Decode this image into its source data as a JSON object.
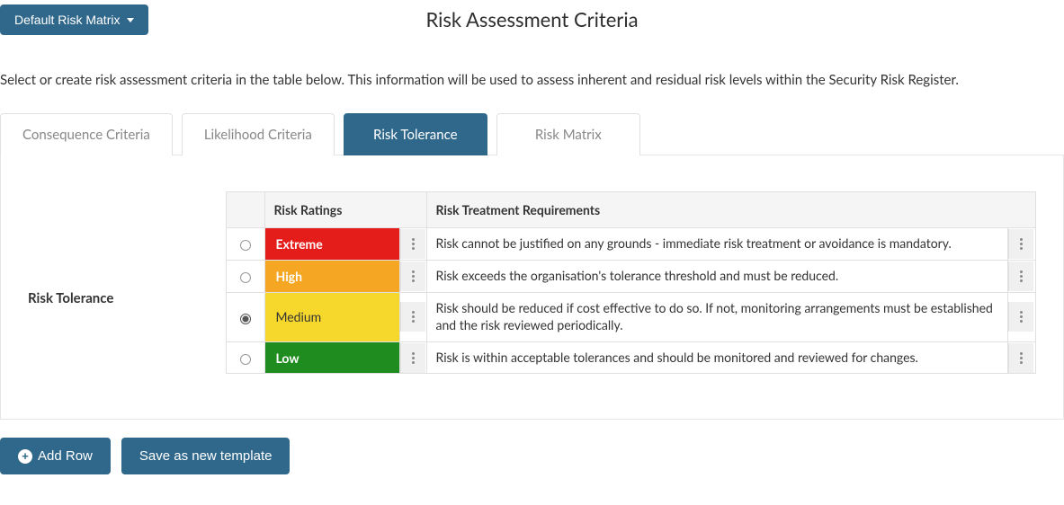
{
  "header": {
    "dropdown_label": "Default Risk Matrix",
    "title": "Risk Assessment Criteria"
  },
  "intro": "Select or create risk assessment criteria in the table below. This information will be used to assess inherent and residual risk levels within the Security Risk Register.",
  "tabs": [
    {
      "label": "Consequence Criteria",
      "active": false
    },
    {
      "label": "Likelihood Criteria",
      "active": false
    },
    {
      "label": "Risk Tolerance",
      "active": true
    },
    {
      "label": "Risk Matrix",
      "active": false
    }
  ],
  "side_label": "Risk Tolerance",
  "table": {
    "columns": {
      "ratings": "Risk Ratings",
      "requirements": "Risk Treatment Requirements"
    },
    "rows": [
      {
        "selected": false,
        "rating": "Extreme",
        "rating_class": "rating-extreme",
        "requirement": "Risk cannot be justified on any grounds - immediate risk treatment or avoidance is mandatory."
      },
      {
        "selected": false,
        "rating": "High",
        "rating_class": "rating-high",
        "requirement": "Risk exceeds the organisation's tolerance threshold and must be reduced."
      },
      {
        "selected": true,
        "rating": "Medium",
        "rating_class": "rating-medium",
        "requirement": "Risk should be reduced if cost effective to do so. If not, monitoring arrangements must be established and the risk reviewed periodically."
      },
      {
        "selected": false,
        "rating": "Low",
        "rating_class": "rating-low",
        "requirement": "Risk is within acceptable tolerances and should be monitored and reviewed for changes."
      }
    ]
  },
  "buttons": {
    "add_row": "Add Row",
    "save_template": "Save as new template"
  }
}
